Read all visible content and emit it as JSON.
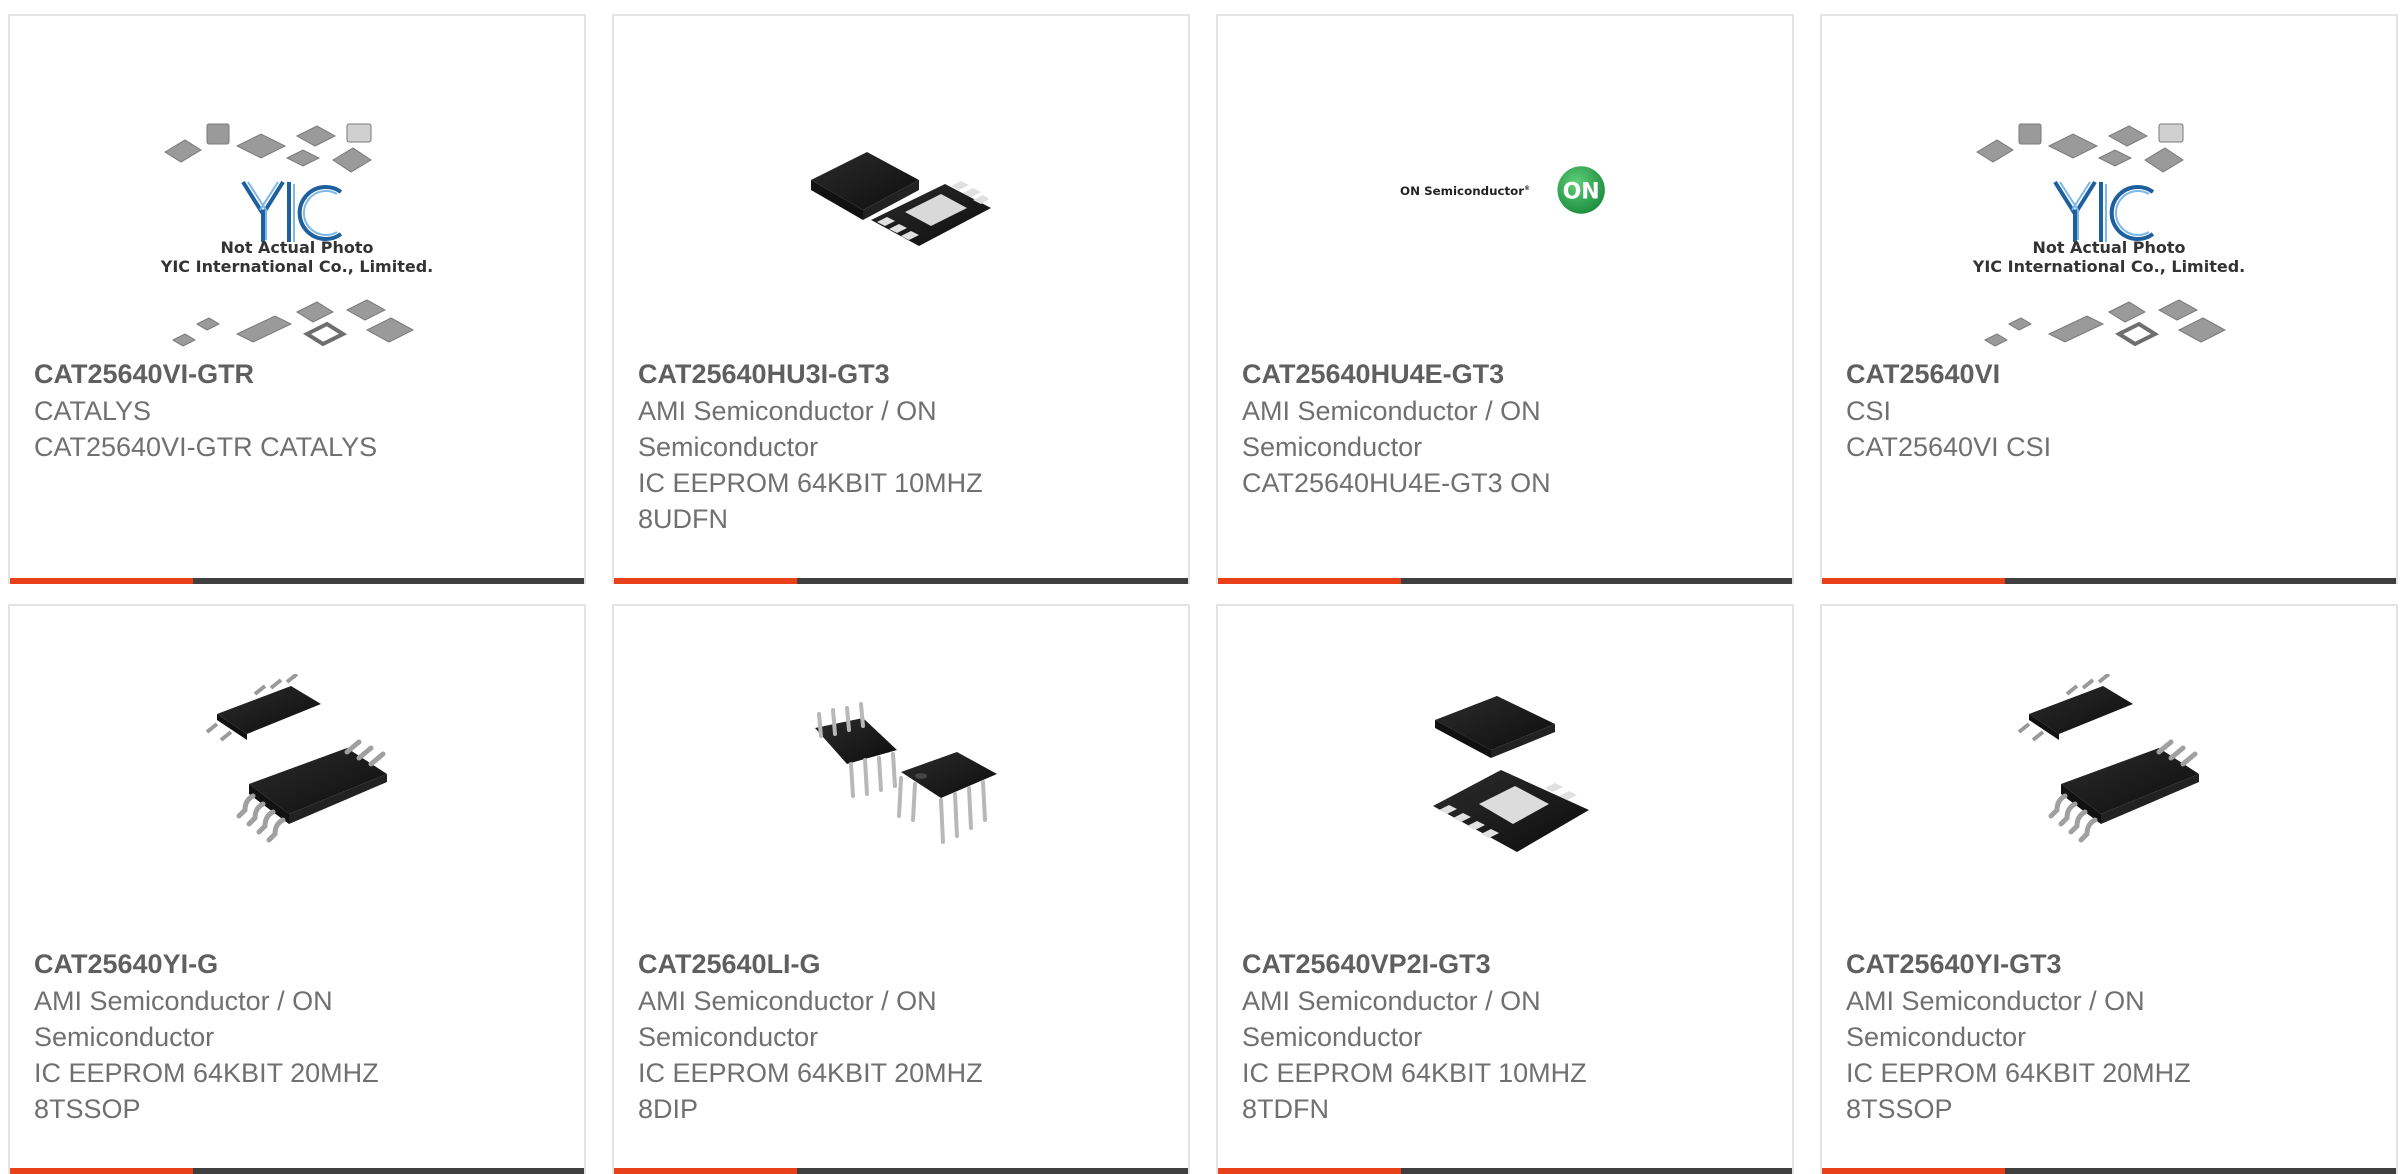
{
  "colors": {
    "accent": "#e8411a",
    "bar": "#3f3f3f",
    "card_border": "#e4e4e4",
    "text": "#6e6e6e"
  },
  "placeholder_logo": {
    "brand": "YIC",
    "line1": "Not Actual Photo",
    "line2": "YIC International Co., Limited."
  },
  "on_logo": {
    "wordmark": "ON Semiconductor",
    "badge": "ON"
  },
  "products": [
    {
      "part": "CAT25640VI-GTR",
      "mfr": [
        "CATALYS"
      ],
      "desc": [
        "CAT25640VI-GTR CATALYS"
      ],
      "image": "placeholder-icon"
    },
    {
      "part": "CAT25640HU3I-GT3",
      "mfr": [
        "AMI Semiconductor / ON",
        "Semiconductor"
      ],
      "desc": [
        "IC EEPROM 64KBIT 10MHZ",
        "8UDFN"
      ],
      "image": "udfn-chip-icon"
    },
    {
      "part": "CAT25640HU4E-GT3",
      "mfr": [
        "AMI Semiconductor / ON",
        "Semiconductor"
      ],
      "desc": [
        "CAT25640HU4E-GT3 ON"
      ],
      "image": "on-semiconductor-logo"
    },
    {
      "part": "CAT25640VI",
      "mfr": [
        "CSI"
      ],
      "desc": [
        "CAT25640VI CSI"
      ],
      "image": "placeholder-icon"
    },
    {
      "part": "CAT25640YI-G",
      "mfr": [
        "AMI Semiconductor / ON",
        "Semiconductor"
      ],
      "desc": [
        "IC EEPROM 64KBIT 20MHZ",
        "8TSSOP"
      ],
      "image": "tssop-chip-icon"
    },
    {
      "part": "CAT25640LI-G",
      "mfr": [
        "AMI Semiconductor / ON",
        "Semiconductor"
      ],
      "desc": [
        "IC EEPROM 64KBIT 20MHZ",
        "8DIP"
      ],
      "image": "dip-chip-icon"
    },
    {
      "part": "CAT25640VP2I-GT3",
      "mfr": [
        "AMI Semiconductor / ON",
        "Semiconductor"
      ],
      "desc": [
        "IC EEPROM 64KBIT 10MHZ",
        "8TDFN"
      ],
      "image": "tdfn-chip-icon"
    },
    {
      "part": "CAT25640YI-GT3",
      "mfr": [
        "AMI Semiconductor / ON",
        "Semiconductor"
      ],
      "desc": [
        "IC EEPROM 64KBIT 20MHZ",
        "8TSSOP"
      ],
      "image": "tssop-chip-icon"
    }
  ]
}
